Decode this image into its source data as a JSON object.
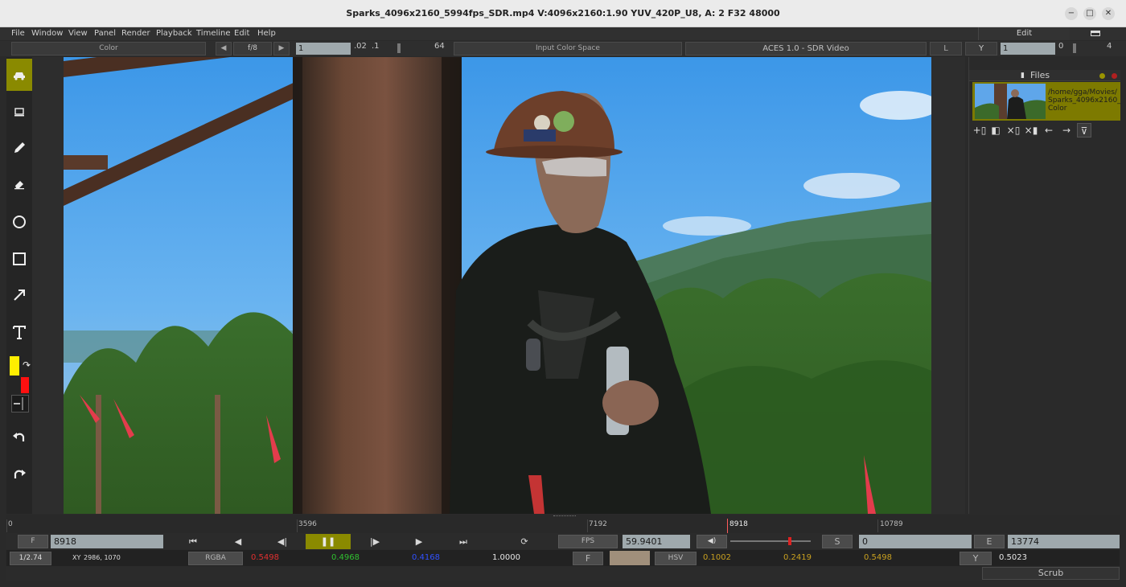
{
  "window": {
    "title": "Sparks_4096x2160_5994fps_SDR.mp4 V:4096x2160:1.90 YUV_420P_U8, A: 2 F32 48000",
    "minimize_icon": "minimize-icon",
    "maximize_icon": "maximize-icon",
    "close_icon": "close-icon"
  },
  "menu": {
    "items": [
      "File",
      "Window",
      "View",
      "Panel",
      "Render",
      "Playback",
      "Timeline",
      "Edit",
      "Help"
    ],
    "edit_mode": "Edit"
  },
  "toolbar": {
    "channel": "Color",
    "fstop": "f/8",
    "gain_value": "1",
    "gain_ticks": [
      ".02",
      ".1",
      "64"
    ],
    "input_color_space": "Input Color Space",
    "display": "ACES 1.0 - SDR Video",
    "lut": "L",
    "gamma_channel": "Y",
    "gamma_value": "1",
    "gamma_ticks": [
      "0",
      "4"
    ]
  },
  "tools": [
    {
      "name": "scrub-tool-icon",
      "active": true
    },
    {
      "name": "selection-tool-icon"
    },
    {
      "name": "pencil-tool-icon"
    },
    {
      "name": "eraser-tool-icon"
    },
    {
      "name": "circle-tool-icon"
    },
    {
      "name": "rectangle-tool-icon"
    },
    {
      "name": "arrow-tool-icon"
    },
    {
      "name": "text-tool-icon"
    },
    {
      "name": "undo-icon"
    },
    {
      "name": "redo-icon"
    }
  ],
  "colors": {
    "foreground": "#ffee00",
    "background": "#ff1010",
    "accent": "#8a8a00",
    "field": "#9fa9ad"
  },
  "files_panel": {
    "title": "Files",
    "entry_lines": [
      "/home/gga/Movies/",
      "Sparks_4096x2160_",
      "Color"
    ]
  },
  "timeline": {
    "labels": [
      "0",
      "3596",
      "7192",
      "8918",
      "10789"
    ],
    "current_frame": 8918
  },
  "transport": {
    "frame_label": "F",
    "frame_value": "8918",
    "fps_label": "FPS",
    "fps_value": "59.9401",
    "start_label": "S",
    "start_value": "0",
    "end_label": "E",
    "end_value": "13774",
    "volume_fraction": 0.72
  },
  "pixel": {
    "zoom": "1/2.74",
    "xy_label": "XY",
    "xy_value": "2986,  1070",
    "rgba_label": "RGBA",
    "r": "0.5498",
    "g": "0.4968",
    "b": "0.4168",
    "a": "1.0000",
    "f_label": "F",
    "swatch_color": "#a08f7b",
    "hsv_label": "HSV",
    "h": "0.1002",
    "s": "0.2419",
    "v": "0.5498",
    "y_label": "Y",
    "y_value": "0.5023"
  },
  "status": {
    "mode": "Scrub"
  }
}
